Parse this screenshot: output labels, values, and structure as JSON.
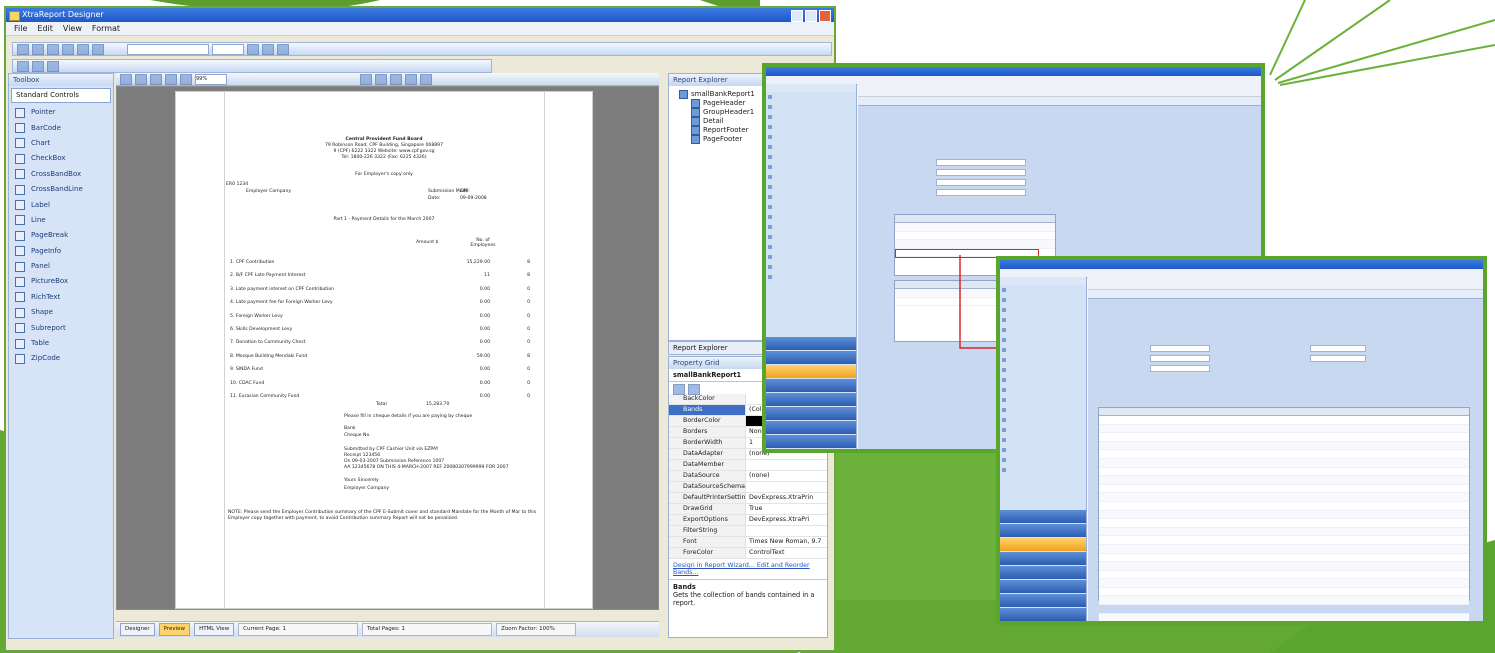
{
  "colors": {
    "accent_green": "#6aa83a",
    "dark_green": "#4f8f22",
    "xp_blue": "#2a62cc",
    "highlight_red": "#d8282a"
  },
  "main_window": {
    "title": "XtraReport Designer",
    "menu": [
      "File",
      "Edit",
      "View",
      "Format"
    ],
    "zoom": "99%",
    "toolbox": {
      "title": "Toolbox",
      "group": "Standard Controls",
      "tools": [
        "Pointer",
        "BarCode",
        "Chart",
        "CheckBox",
        "CrossBandBox",
        "CrossBandLine",
        "Label",
        "Line",
        "PageBreak",
        "PageInfo",
        "Panel",
        "PictureBox",
        "RichText",
        "Shape",
        "Subreport",
        "Table",
        "ZipCode"
      ]
    },
    "report": {
      "header_lines": [
        "Central Provident Fund Board",
        "79 Robinson Road, CPF Building, Singapore 068897",
        "9 (CPF) 6222 3322 Website: www.cpf.gov.sg",
        "Tel: 1800-226 3322 (Fax: 6225 4326)"
      ],
      "subtitle": "For Employer's copy only",
      "employer_ref": "ER0 1234",
      "employer_name": "Employer Company",
      "submission_label": "Submission Mode:",
      "submission_value": "CPF",
      "date_label": "Date:",
      "date_value": "09-09-2008",
      "part_title": "Part 1 - Payment Details for the March 2007",
      "col_amount": "Amount $",
      "col_employees": "No. of Employees",
      "items": [
        {
          "label": "1. CPF Contribution",
          "amount": "15,229.00",
          "num": "8"
        },
        {
          "label": "2. B/F CPF Late Payment Interest",
          "amount": "11",
          "num": "8"
        },
        {
          "label": "3. Late payment interest on CPF Contribution",
          "amount": "0.00",
          "num": "0"
        },
        {
          "label": "4. Late payment fee for Foreign Worker Levy",
          "amount": "0.00",
          "num": "0"
        },
        {
          "label": "5. Foreign Worker Levy",
          "amount": "0.00",
          "num": "0"
        },
        {
          "label": "6. Skills Development Levy",
          "amount": "0.00",
          "num": "0"
        },
        {
          "label": "7. Donation to Community Chest",
          "amount": "0.00",
          "num": "0"
        },
        {
          "label": "8. Mosque Building Mendaki Fund",
          "amount": "59.00",
          "num": "8"
        },
        {
          "label": "9. SINDA Fund",
          "amount": "0.00",
          "num": "0"
        },
        {
          "label": "10. CDAC Fund",
          "amount": "0.00",
          "num": "0"
        },
        {
          "label": "11. Eurasian Community Fund",
          "amount": "0.00",
          "num": "0"
        }
      ],
      "total_label": "Total",
      "total_value": "15,283.70",
      "note_line": "Please fill in cheque details if you are paying by cheque",
      "bank_label": "Bank",
      "cheque_label": "Cheque No.",
      "fine_print": [
        "Submitted by CPF Cashier Unit via EZPAY",
        "Receipt 123456",
        "On 09-03-2007 Submission Reference 1007",
        "AA 12345678 ON THIS 4-MARCH-2007 REF 20080307999999 FOR 2007",
        "Yours Sincerely"
      ],
      "signature": "Employer Company",
      "notes": "NOTE: Please send the Employer Contribution summary of the CPF E-Submit cover and standard Mandate for the Month of Mar to this Employer copy together with payment, to avoid Contribution summary Report will not be penalized."
    },
    "status": {
      "tab_designer": "Designer",
      "tab_preview": "Preview",
      "tab_html": "HTML View",
      "current_page": "Current Page: 1",
      "total_pages": "Total Pages: 1",
      "zoom_factor": "Zoom Factor: 100%"
    },
    "explorer": {
      "title": "Report Explorer",
      "tree": [
        "smallBankReport1",
        "PageHeader",
        "GroupHeader1",
        "Detail",
        "ReportFooter",
        "PageFooter"
      ],
      "tab_label": "Report Explorer"
    },
    "properties": {
      "title": "Property Grid",
      "object": "smallBankReport1",
      "rows": [
        {
          "key": "BackColor",
          "value": ""
        },
        {
          "key": "Bands",
          "value": "(Collection)"
        },
        {
          "key": "BorderColor",
          "value": ""
        },
        {
          "key": "Borders",
          "value": "None"
        },
        {
          "key": "BorderWidth",
          "value": "1"
        },
        {
          "key": "DataAdapter",
          "value": "(none)"
        },
        {
          "key": "DataMember",
          "value": ""
        },
        {
          "key": "DataSource",
          "value": "(none)"
        },
        {
          "key": "DataSourceSchema",
          "value": ""
        },
        {
          "key": "DefaultPrinterSettings",
          "value": "DevExpress.XtraPrin"
        },
        {
          "key": "DrawGrid",
          "value": "True"
        },
        {
          "key": "ExportOptions",
          "value": "DevExpress.XtraPri"
        },
        {
          "key": "FilterString",
          "value": ""
        },
        {
          "key": "Font",
          "value": "Times New Roman, 9.7"
        },
        {
          "key": "ForeColor",
          "value": "ControlText"
        }
      ],
      "links": "Design in Report Wizard...  Edit and Reorder Bands...",
      "desc_title": "Bands",
      "desc_text": "Gets the collection of bands contained in a report."
    }
  }
}
